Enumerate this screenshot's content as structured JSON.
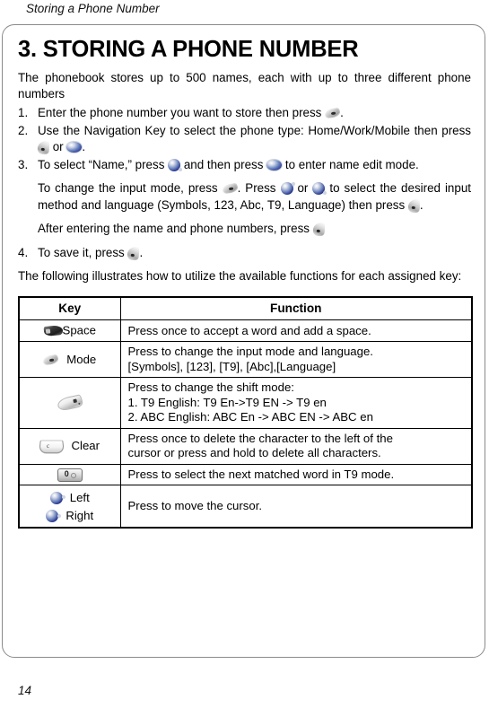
{
  "running_header": "Storing a Phone Number",
  "page_number": "14",
  "chapter": {
    "title": "3. STORING A PHONE NUMBER",
    "intro": "The phonebook stores up to 500 names, each with up to three different phone numbers"
  },
  "steps": [
    {
      "num": "1.",
      "parts": [
        "Enter the phone number you want to store then press ",
        "",
        "."
      ],
      "icons": [
        "softkey-left-icon"
      ]
    },
    {
      "num": "2.",
      "parts": [
        "Use the Navigation Key to select the phone type: Home/Work/Mobile then press ",
        " or ",
        "."
      ],
      "icons": [
        "softkey-up-icon",
        "nav-ok-icon"
      ]
    },
    {
      "num": "3.",
      "parts": [
        "To select “Name,” press ",
        " and then press ",
        " to enter name edit mode."
      ],
      "icons": [
        "nav-down-icon",
        "nav-ok-icon"
      ]
    },
    {
      "num": "4.",
      "parts": [
        "To save it, press ",
        "."
      ],
      "icons": [
        "softkey-up-icon"
      ]
    }
  ],
  "sub_paragraphs": {
    "input_mode": {
      "p1": "To change the input mode, press ",
      "p2": ". Press ",
      "p3": " or ",
      "p4": " to select the desired input method and language (Symbols, 123, Abc, T9, Language) then press ",
      "p5": "."
    },
    "after_entering": {
      "p1": "After entering the name and phone numbers, press ",
      "p2": ""
    }
  },
  "following_text": "The following illustrates how to utilize the available functions for each assigned key:",
  "table": {
    "headers": [
      "Key",
      "Function"
    ],
    "rows": [
      {
        "icon": "space-key-icon",
        "key_label": "Space",
        "label_position": "after",
        "function_lines": [
          "Press once to accept a word and add a space."
        ]
      },
      {
        "icon": "softkey-left-icon",
        "key_label": "Mode",
        "label_position": "after",
        "function_lines": [
          "Press to change the input mode and language.",
          "[Symbols], [123], [T9], [Abc],[Language]"
        ]
      },
      {
        "icon": "shift-key-icon",
        "key_label": "",
        "label_position": "none",
        "function_lines": [
          "Press to change the shift mode:",
          "1. T9 English: T9 En->T9 EN -> T9 en",
          "2. ABC English: ABC En -> ABC EN -> ABC en"
        ]
      },
      {
        "icon": "clear-key-icon",
        "key_label": "Clear",
        "label_position": "after",
        "function_lines": [
          "Press once to delete the character to the left of the",
          "cursor or press and hold to delete all characters."
        ]
      },
      {
        "icon": "zero-key-icon",
        "key_label": "",
        "label_position": "none",
        "function_lines": [
          "Press to select the next matched word in T9 mode."
        ]
      },
      {
        "icon": "nav-left-right-icon",
        "key_label_1": "Left",
        "key_label_2": "Right",
        "label_position": "pair",
        "function_lines": [
          "Press to move the cursor."
        ]
      }
    ]
  },
  "colors": {
    "nav_key_blue": "#23378c",
    "border_gray": "#8a8a8a",
    "table_border": "#000000",
    "text": "#000000"
  }
}
